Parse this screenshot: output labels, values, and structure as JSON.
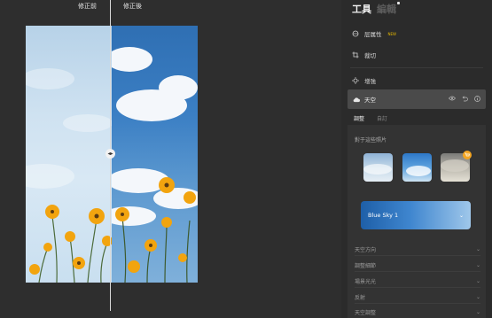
{
  "canvas": {
    "before_label": "修正前",
    "after_label": "修正後",
    "split_handle_glyph": "◂▸"
  },
  "panel": {
    "tab_tools": "工具",
    "tab_edit": "編輯",
    "tools": [
      {
        "label": "层属性",
        "tag": "NEW",
        "icon": "layers-icon"
      },
      {
        "label": "裁切",
        "icon": "crop-icon"
      },
      {
        "label": "增強",
        "icon": "enhance-icon"
      }
    ],
    "sky": {
      "title": "天空",
      "sub_tabs": [
        "調整",
        "自訂"
      ],
      "section_title": "對于這些照片",
      "selected_sky": "Blue Sky 1",
      "accordion": [
        "天空方向",
        "調整細節",
        "場景光光",
        "反射",
        "天空調整"
      ]
    }
  }
}
